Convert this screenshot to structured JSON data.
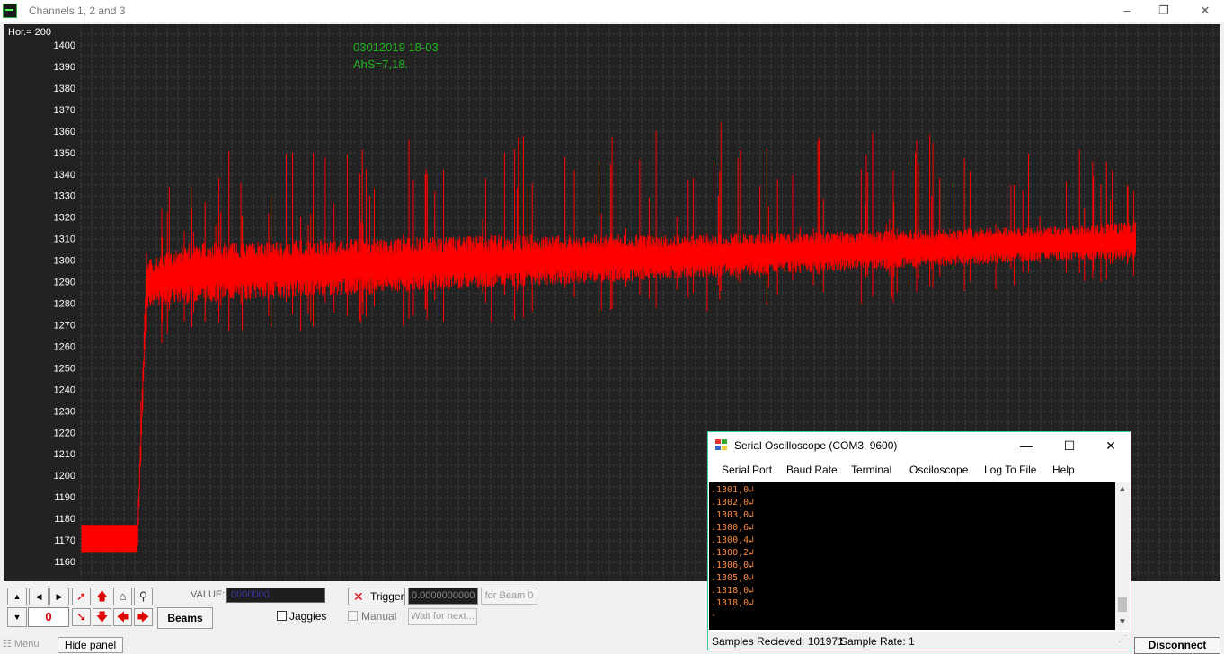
{
  "window": {
    "title": "Channels 1, 2 and 3"
  },
  "plot": {
    "hor_label": "Hor.= 200",
    "annotation_line1": "03012019 18-03",
    "annotation_line2": "AhS=7,18."
  },
  "chart_data": {
    "type": "line",
    "title": "",
    "xlabel": "",
    "ylabel": "",
    "ylim": [
      1155,
      1405
    ],
    "y_ticks": [
      "1400",
      "1390",
      "1380",
      "1370",
      "1360",
      "1350",
      "1340",
      "1330",
      "1320",
      "1310",
      "1300",
      "1290",
      "1280",
      "1270",
      "1260",
      "1250",
      "1240",
      "1230",
      "1220",
      "1210",
      "1200",
      "1190",
      "1180",
      "1170",
      "1160"
    ],
    "grid": true,
    "series_color": "#ff0000",
    "baseline_segment": {
      "min": 1164,
      "max": 1177
    },
    "envelope": {
      "x": [
        0,
        62,
        72,
        120,
        300,
        500,
        700,
        900,
        1100,
        1173
      ],
      "low": [
        1164,
        1164,
        1260,
        1262,
        1268,
        1272,
        1276,
        1280,
        1288,
        1292
      ],
      "mid_low": [
        1164,
        1164,
        1278,
        1280,
        1284,
        1288,
        1292,
        1296,
        1300,
        1300
      ],
      "mid_high": [
        1177,
        1177,
        1300,
        1308,
        1310,
        1312,
        1312,
        1314,
        1316,
        1318
      ],
      "high": [
        1177,
        1177,
        1340,
        1350,
        1355,
        1362,
        1366,
        1360,
        1355,
        1345
      ]
    }
  },
  "controls": {
    "counter_value": "0",
    "beams_label": "Beams",
    "value_label": "VALUE:",
    "value_box": "0000000",
    "jaggies_label": "Jaggies",
    "trigger_label": "Trigger",
    "trigger_value": "0.0000000000",
    "for_beam_label": "for Beam 0",
    "manual_label": "Manual",
    "wait_label": "Wait for next..."
  },
  "statusbar": {
    "menu_label": "Menu",
    "hide_panel_label": "Hide panel",
    "disconnect_label": "Disconnect"
  },
  "serial": {
    "title": "Serial Oscilloscope (COM3, 9600)",
    "menu": [
      "Serial Port",
      "Baud Rate",
      "Terminal",
      "Osciloscope",
      "Log To File",
      "Help"
    ],
    "lines": [
      ".1301,0↲",
      ".1302,0↲",
      ".1303,0↲",
      ".1300,6↲",
      ".1300,4↲",
      ".1300,2↲",
      ".1306,0↲",
      ".1305,0↲",
      ".1318,0↲",
      ".1318,0↲"
    ],
    "cursor": "-",
    "samples_label": "Samples Recieved: 101971",
    "rate_label": "Sample Rate: 1"
  }
}
